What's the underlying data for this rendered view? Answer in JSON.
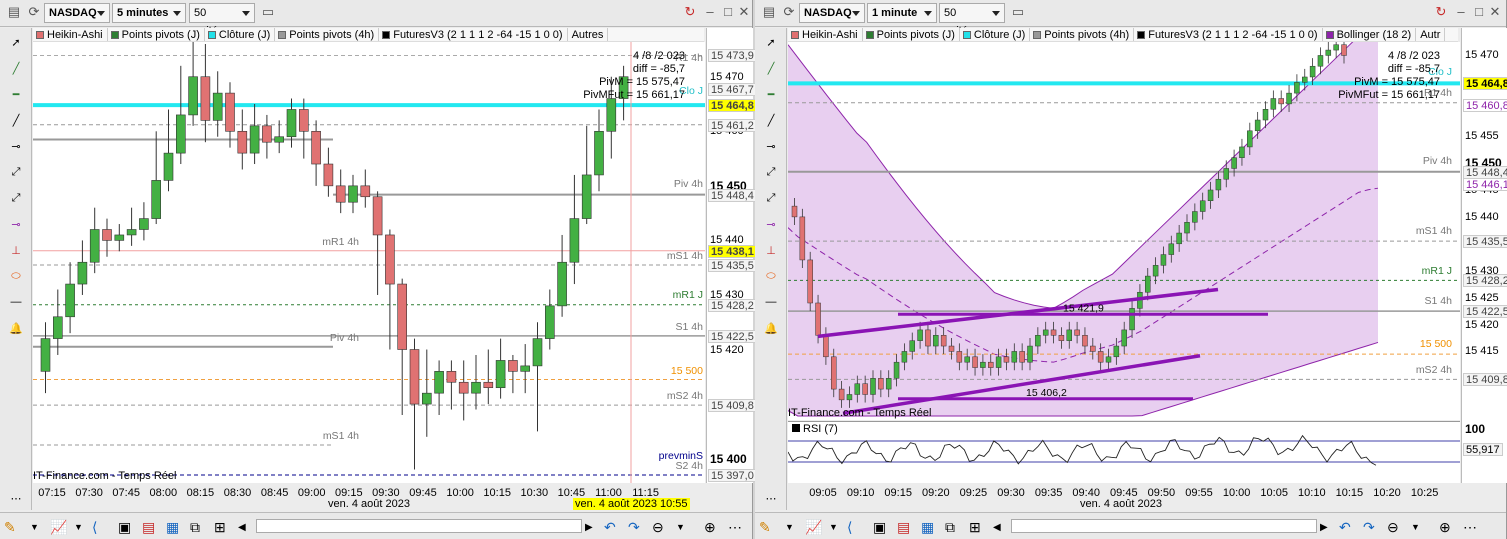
{
  "left": {
    "symbol": "NASDAQ",
    "interval": "5 minutes",
    "units": "50 unités",
    "indicators": [
      {
        "label": "Heikin-Ashi",
        "color": "#e07070"
      },
      {
        "label": "Points pivots (J)",
        "color": "#2e7d32"
      },
      {
        "label": "Clôture (J)",
        "color": "#22e0e8"
      },
      {
        "label": "Points pivots (4h)",
        "color": "#999999"
      },
      {
        "label": "FuturesV3 (2 1 1 1 2 -64 -15 1 0 0)",
        "color": "#000000"
      },
      {
        "label": "Autres",
        "color": ""
      }
    ],
    "info": {
      "date": "4 /8 /2 023",
      "diff": "diff = -85,7",
      "pivm": "PivM = 15 575,47",
      "pivmfut": "PivMFut = 15 661,17"
    },
    "axis_ticks": [
      "15 470",
      "15 460",
      "15 450",
      "15 440",
      "15 430",
      "15 420",
      "15 410",
      "15 400"
    ],
    "price_labels": [
      {
        "text": "15 473,9",
        "style": "plain"
      },
      {
        "text": "15 467,7",
        "style": "plain"
      },
      {
        "text": "15 464,8",
        "style": "yellow"
      },
      {
        "text": "15 461,2",
        "style": "plain"
      },
      {
        "text": "15 448,4",
        "style": "plain"
      },
      {
        "text": "15 438,1",
        "style": "yellow"
      },
      {
        "text": "15 435,5",
        "style": "plain"
      },
      {
        "text": "15 428,2",
        "style": "plain"
      },
      {
        "text": "15 422,5",
        "style": "plain"
      },
      {
        "text": "15 409,8",
        "style": "plain"
      },
      {
        "text": "15 397,0",
        "style": "plain"
      }
    ],
    "line_labels": [
      "R1 4h",
      "Clo J",
      "Piv 4h",
      "mR1 4h",
      "mS1 4h",
      "mR1 J",
      "S1 4h",
      "Piv 4h",
      "15 500",
      "mS2 4h",
      "mS1 4h",
      "prevminS",
      "S2 4h"
    ],
    "time_labels": [
      "07:15",
      "07:30",
      "07:45",
      "08:00",
      "08:15",
      "08:30",
      "08:45",
      "09:00",
      "09:15",
      "09:30",
      "09:45",
      "10:00",
      "10:15",
      "10:30",
      "10:45",
      "11:00",
      "11:15"
    ],
    "date_label": "ven. 4 août 2023",
    "cursor_date": "ven. 4 août 2023 10:55",
    "source": "IT-Finance.com - Temps Réel"
  },
  "right": {
    "symbol": "NASDAQ",
    "interval": "1 minute",
    "units": "50 unités",
    "indicators": [
      {
        "label": "Heikin-Ashi",
        "color": "#e07070"
      },
      {
        "label": "Points pivots (J)",
        "color": "#2e7d32"
      },
      {
        "label": "Clôture (J)",
        "color": "#22e0e8"
      },
      {
        "label": "Points pivots (4h)",
        "color": "#999999"
      },
      {
        "label": "FuturesV3 (2 1 1 1 2 -64 -15 1 0 0)",
        "color": "#000000"
      },
      {
        "label": "Bollinger (18 2)",
        "color": "#8e24aa"
      },
      {
        "label": "Autr",
        "color": ""
      }
    ],
    "info": {
      "date": "4 /8 /2 023",
      "diff": "diff = -85,7",
      "pivm": "PivM = 15 575,47",
      "pivmfut": "PivMFut = 15 661,17"
    },
    "axis_ticks": [
      "15 470",
      "15 465",
      "15 460",
      "15 455",
      "15 450",
      "15 445",
      "15 440",
      "15 435",
      "15 430",
      "15 425",
      "15 420",
      "15 415",
      "15 410"
    ],
    "price_labels": [
      {
        "text": "15 464,8",
        "style": "yellow"
      },
      {
        "text": "15 460,8",
        "style": "purple"
      },
      {
        "text": "15 448,4",
        "style": "plain"
      },
      {
        "text": "15 446,1",
        "style": "purple"
      },
      {
        "text": "15 435,5",
        "style": "plain"
      },
      {
        "text": "15 428,2",
        "style": "plain"
      },
      {
        "text": "15 422,5",
        "style": "plain"
      },
      {
        "text": "15 409,8",
        "style": "plain"
      }
    ],
    "line_labels": [
      "Clo J",
      "R1 4h",
      "Piv 4h",
      "mS1 4h",
      "mR1 J",
      "S1 4h",
      "15 500",
      "mS2 4h"
    ],
    "annotations": [
      "15 421,9",
      "15 406,2"
    ],
    "rsi": {
      "label": "RSI (7)",
      "value": "55,917",
      "top_tick": "100"
    },
    "time_labels": [
      "09:05",
      "09:10",
      "09:15",
      "09:20",
      "09:25",
      "09:30",
      "09:35",
      "09:40",
      "09:45",
      "09:50",
      "09:55",
      "10:00",
      "10:05",
      "10:10",
      "10:15",
      "10:20",
      "10:25"
    ],
    "date_label": "ven. 4 août 2023",
    "source": "IT-Finance.com - Temps Réel"
  },
  "colors": {
    "up": "#43b043",
    "down": "#e07272",
    "clo": "#22e8f0",
    "boll": "#8e24aa",
    "highlight": "#ffff00",
    "axis_purple": "#8e24aa"
  }
}
